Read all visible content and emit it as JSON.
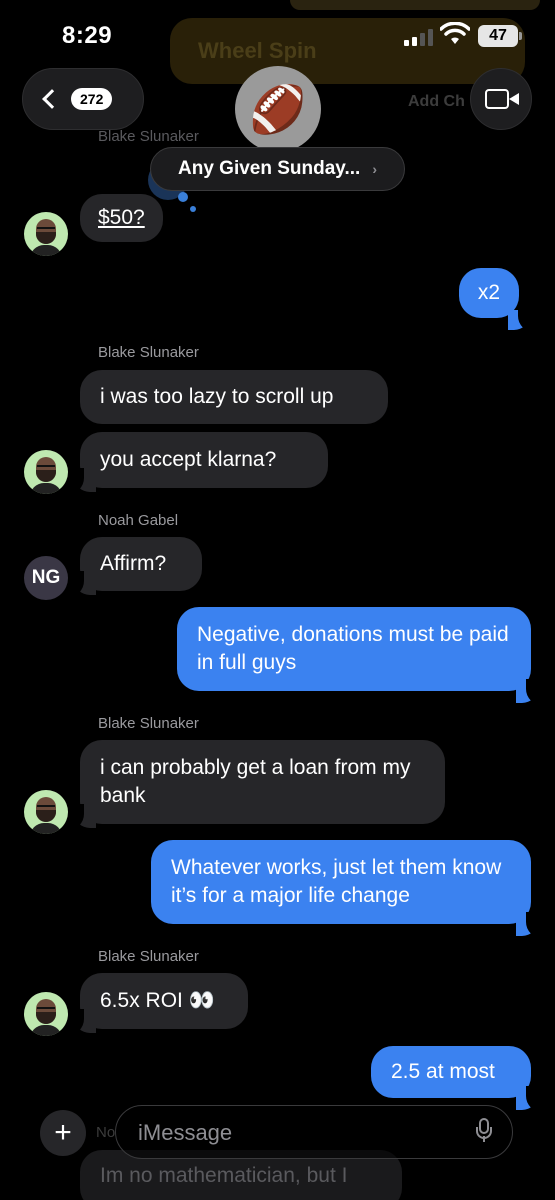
{
  "status_bar": {
    "time": "8:29",
    "battery": "47"
  },
  "header": {
    "back_count": "272",
    "group_avatar": "🏈",
    "group_name": "Any Given Sunday...",
    "group_chevron": "›",
    "ghost_app": "Wheel Spin",
    "ghost_add": "Add Ch"
  },
  "messages": [
    {
      "sender": "Blake Slunaker",
      "text": "$50?",
      "direction": "in"
    },
    {
      "text": "x2",
      "direction": "out"
    },
    {
      "sender": "Blake Slunaker",
      "text": "i was too lazy to scroll up",
      "direction": "in"
    },
    {
      "text": "you accept klarna?",
      "direction": "in"
    },
    {
      "sender": "Noah Gabel",
      "avatar_initials": "NG",
      "text": "Affirm?",
      "direction": "in"
    },
    {
      "text": "Negative, donations must be paid in full guys",
      "direction": "out"
    },
    {
      "sender": "Blake Slunaker",
      "text": "i can probably get a loan from my bank",
      "direction": "in"
    },
    {
      "text": "Whatever works, just let them know it’s for a major life change",
      "direction": "out"
    },
    {
      "sender": "Blake Slunaker",
      "text": "6.5x ROI 👀",
      "direction": "in"
    },
    {
      "text": "2.5 at most",
      "direction": "out"
    },
    {
      "sender_partial": "No",
      "text_partial": "Im no mathematician, but I"
    }
  ],
  "composer": {
    "placeholder": "iMessage",
    "plus": "+"
  },
  "colors": {
    "outgoing": "#3b82f0",
    "incoming": "#262629",
    "background": "#000000"
  }
}
